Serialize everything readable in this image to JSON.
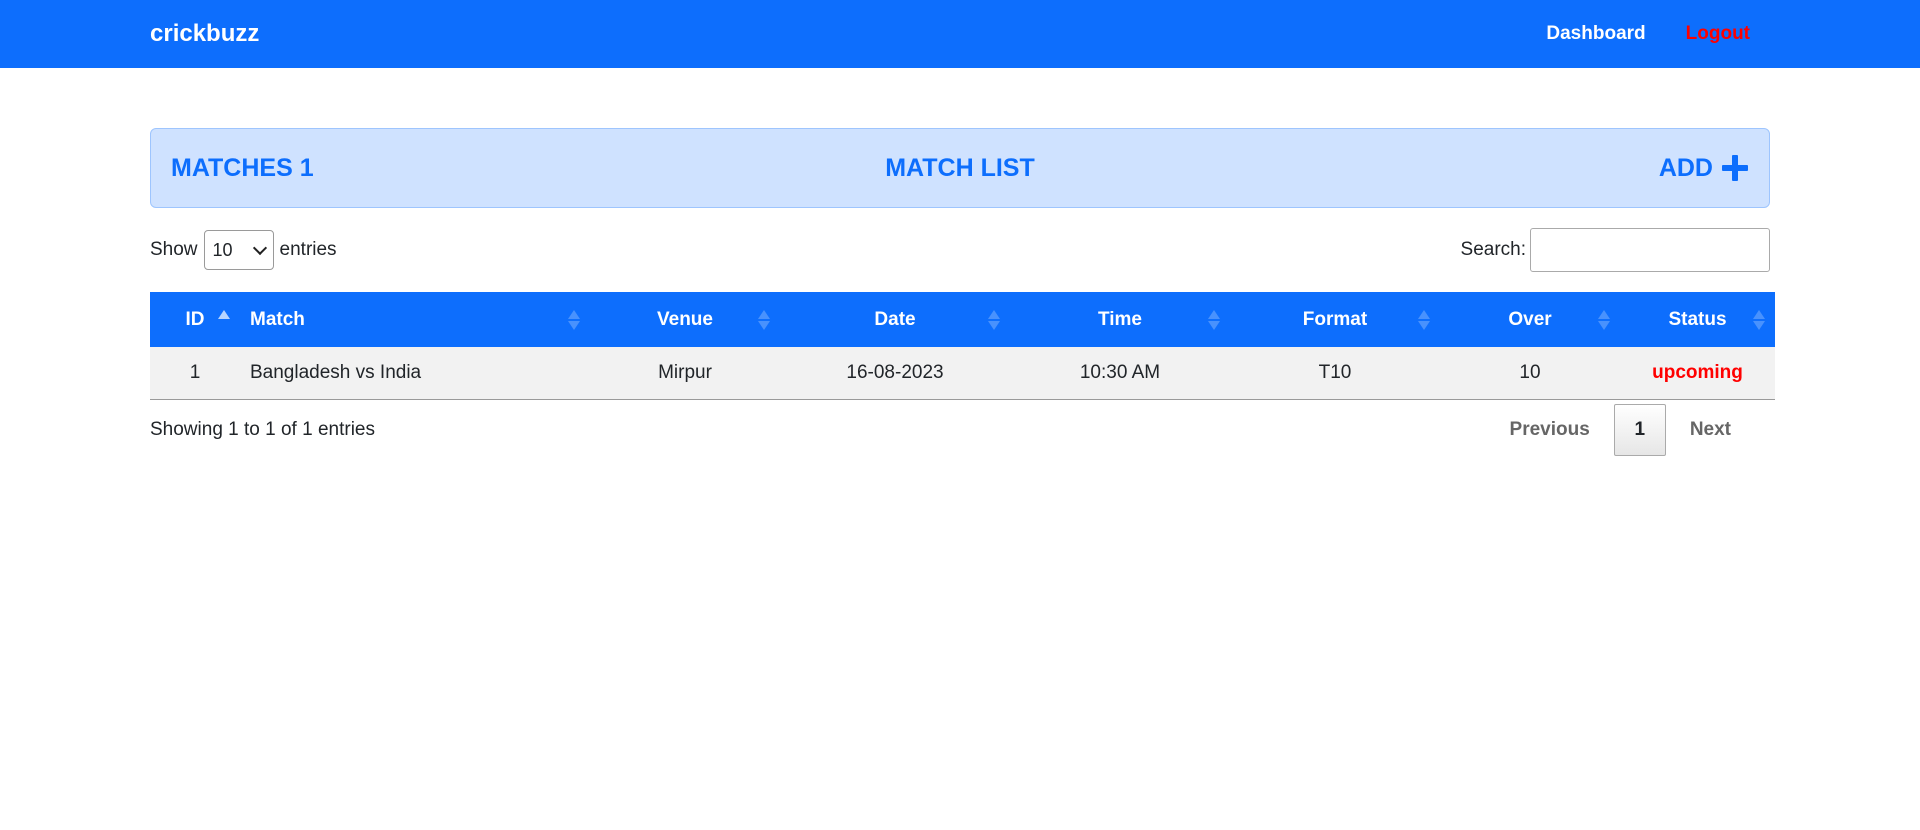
{
  "navbar": {
    "brand": "crickbuzz",
    "links": [
      {
        "label": "Dashboard"
      },
      {
        "label": "Logout"
      }
    ]
  },
  "header": {
    "count_label": "MATCHES 1",
    "title": "MATCH LIST",
    "add_label": "ADD",
    "add_icon": "plus-icon"
  },
  "controls": {
    "show_label": "Show",
    "entries_value": "10",
    "entries_label": "entries",
    "search_label": "Search:",
    "search_value": ""
  },
  "table": {
    "columns": [
      "ID",
      "Match",
      "Venue",
      "Date",
      "Time",
      "Format",
      "Over",
      "Status"
    ],
    "rows": [
      {
        "id": "1",
        "match": "Bangladesh vs India",
        "venue": "Mirpur",
        "date": "16-08-2023",
        "time": "10:30 AM",
        "format": "T10",
        "over": "10",
        "status": "upcoming"
      }
    ]
  },
  "footer": {
    "info": "Showing 1 to 1 of 1 entries",
    "prev": "Previous",
    "page": "1",
    "next": "Next"
  },
  "colors": {
    "primary": "#0d6efd",
    "header_bg": "#cfe2ff",
    "status_red": "#ff0000"
  }
}
